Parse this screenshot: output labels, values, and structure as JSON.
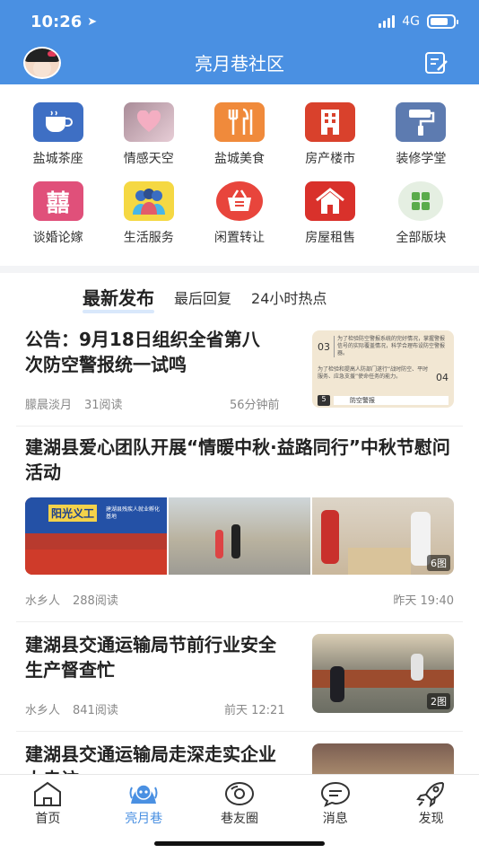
{
  "status_bar": {
    "time": "10:26",
    "network": "4G",
    "battery_level": 0.8
  },
  "header": {
    "title": "亮月巷社区"
  },
  "categories": [
    {
      "label": "盐城茶座",
      "icon": "teacup-icon",
      "color": "#3e6fc4"
    },
    {
      "label": "情感天空",
      "icon": "heart-photo-icon",
      "color": "#d8b7c3"
    },
    {
      "label": "盐城美食",
      "icon": "cutlery-icon",
      "color": "#f08a3b"
    },
    {
      "label": "房产楼市",
      "icon": "building-icon",
      "color": "#d9412c"
    },
    {
      "label": "装修学堂",
      "icon": "paint-roller-icon",
      "color": "#5d7bb0"
    },
    {
      "label": "谈婚论嫁",
      "icon": "double-happiness-icon",
      "color": "#e0507a"
    },
    {
      "label": "生活服务",
      "icon": "people-icon",
      "color": "#f5d843"
    },
    {
      "label": "闲置转让",
      "icon": "basket-icon",
      "color": "#e8453c"
    },
    {
      "label": "房屋租售",
      "icon": "house-icon",
      "color": "#d9312b"
    },
    {
      "label": "全部版块",
      "icon": "grid-icon",
      "color": "#e5efe2"
    }
  ],
  "tabs": [
    {
      "label": "最新发布",
      "active": true
    },
    {
      "label": "最后回复",
      "active": false
    },
    {
      "label": "24小时热点",
      "active": false
    }
  ],
  "articles": [
    {
      "title": "公告：9月18日组织全省第八次防空警报统一试鸣",
      "author": "朦晨淡月",
      "reads": "31阅读",
      "time": "56分钟前",
      "thumb_texts": [
        "为了检验防空警报系统的完好情况，掌握警报信号的实际覆盖情况，科学合理布设防空警报器。",
        "为了检验和提高人防部门遂行“战时防空、平时服务、应急支援”使命任务的能力。",
        "防空警报"
      ],
      "thumb_numbers": [
        "03",
        "04",
        "5"
      ]
    },
    {
      "title": "建湖县爱心团队开展“情暖中秋·益路同行”中秋节慰问活动",
      "author": "水乡人",
      "reads": "288阅读",
      "time": "昨天 19:40",
      "image_count": "6图",
      "photo_text": [
        "阳光义工",
        "建湖县残疾人就业孵化基地"
      ]
    },
    {
      "title": "建湖县交通运输局节前行业安全生产督查忙",
      "author": "水乡人",
      "reads": "841阅读",
      "time": "前天 12:21",
      "image_count": "2图"
    },
    {
      "title": "建湖县交通运输局走深走实企业大走访"
    }
  ],
  "tabbar": [
    {
      "label": "首页",
      "icon": "home-icon",
      "active": false
    },
    {
      "label": "亮月巷",
      "icon": "moon-mascot-icon",
      "active": true
    },
    {
      "label": "巷友圈",
      "icon": "circle-icon",
      "active": false
    },
    {
      "label": "消息",
      "icon": "message-icon",
      "active": false
    },
    {
      "label": "发现",
      "icon": "rocket-icon",
      "active": false
    }
  ],
  "colors": {
    "primary": "#4a90e2"
  }
}
